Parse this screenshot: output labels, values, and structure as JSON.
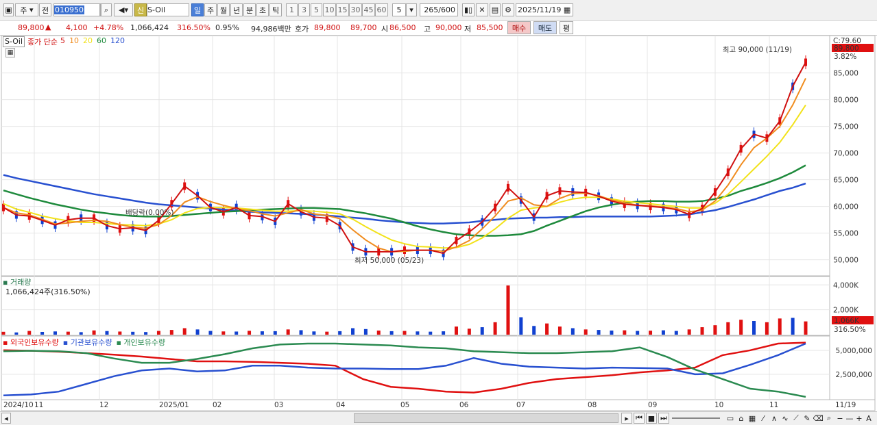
{
  "toolbar": {
    "type_select": "주",
    "prev_label": "전",
    "code": "010950",
    "badge": "신",
    "stock_name": "S-Oil",
    "periods": [
      "일",
      "주",
      "월",
      "년",
      "분",
      "초",
      "틱"
    ],
    "active_period": "일",
    "intervals": [
      "1",
      "3",
      "5",
      "10",
      "15",
      "30",
      "45",
      "60"
    ],
    "interval_value": "5",
    "count": "265",
    "max": "600",
    "date": "2025/11/19"
  },
  "quote": {
    "price": "89,800",
    "change": "4,100",
    "change_pct": "+4.78%",
    "volume": "1,066,424",
    "volume_ratio": "316.50%",
    "turnover": "0.95%",
    "amount": "94,986백만",
    "ask_label": "호가",
    "ask": "89,800",
    "bid": "89,700",
    "open_label": "시",
    "open": "86,500",
    "high_label": "고",
    "high": "90,000",
    "low_label": "저",
    "low": "85,500",
    "buy_btn": "매수",
    "sell_btn": "매도",
    "eval_btn": "평"
  },
  "panels": {
    "price_legend": {
      "name": "S-Oil",
      "label": "종가 단순",
      "periods": [
        "5",
        "10",
        "20",
        "60",
        "120"
      ]
    },
    "volume_title": "거래량",
    "volume_info": "1,066,424주(316.50%)",
    "holding_legend": [
      "외국인보유수량",
      "기관보유수량",
      "개인보유수량"
    ]
  },
  "colors": {
    "up": "#e01010",
    "down": "#1040d0",
    "ma5": "#d01010",
    "ma10": "#f08c1e",
    "ma20": "#f2e21a",
    "ma60": "#1e8a3c",
    "ma120": "#2850d0",
    "foreign": "#e01010",
    "institution": "#2850d0",
    "individual": "#2a8a50"
  },
  "chart_data": [
    {
      "type": "candlestick",
      "title": "S-Oil",
      "ylim": [
        47000,
        92000
      ],
      "yticks": [
        "85,000",
        "80,000",
        "75,000",
        "70,000",
        "65,000",
        "60,000",
        "55,000",
        "50,000"
      ],
      "annotations": {
        "high": "최고 90,000 (11/19)",
        "low": "최저 50,000 (05/23)",
        "dividend": "배당락(0.00%)"
      },
      "right_labels": {
        "c": "C:79.60",
        "last": "89,800",
        "pct": "3.82%"
      },
      "ma": [
        {
          "name": "5",
          "values": [
            59800,
            58400,
            58200,
            57400,
            56500,
            57500,
            57800,
            57800,
            56400,
            55800,
            56000,
            55500,
            57400,
            60500,
            63800,
            62000,
            59800,
            59000,
            59800,
            58300,
            58100,
            57200,
            60500,
            59000,
            58000,
            57800,
            56400,
            52400,
            51500,
            51500,
            51500,
            51800,
            51800,
            51800,
            51200,
            53600,
            55200,
            57100,
            59800,
            63500,
            61200,
            58000,
            62000,
            62900,
            62700,
            62600,
            61900,
            61000,
            60400,
            60200,
            60000,
            59800,
            59400,
            58500,
            59600,
            62700,
            66400,
            70800,
            73500,
            72800,
            76000,
            82500,
            87000
          ]
        },
        {
          "name": "10",
          "values": [
            59800,
            58800,
            58400,
            57600,
            56700,
            56900,
            57200,
            57400,
            57200,
            56600,
            56100,
            55900,
            56600,
            58300,
            60800,
            61800,
            60900,
            60200,
            59600,
            59200,
            58600,
            58200,
            58800,
            59400,
            58600,
            58300,
            57700,
            55600,
            53700,
            52200,
            51500,
            51600,
            51800,
            51800,
            51600,
            52400,
            53600,
            55800,
            58200,
            61000,
            61600,
            60300,
            60000,
            61500,
            62400,
            62500,
            62000,
            61200,
            60700,
            60200,
            60100,
            59900,
            59600,
            59000,
            59300,
            61000,
            64000,
            67800,
            71000,
            72800,
            75000,
            79000,
            84000
          ]
        },
        {
          "name": "20",
          "values": [
            60500,
            59500,
            58900,
            58200,
            57700,
            57300,
            57000,
            57000,
            56800,
            56600,
            56500,
            56400,
            56700,
            57500,
            58800,
            59600,
            59800,
            59800,
            59700,
            59500,
            59300,
            59100,
            59100,
            59200,
            59100,
            58900,
            58600,
            57600,
            56200,
            54900,
            53700,
            53000,
            52500,
            52400,
            52200,
            52300,
            52900,
            54100,
            55800,
            57800,
            59300,
            59700,
            60000,
            60800,
            61400,
            61700,
            61700,
            61400,
            61000,
            60700,
            60500,
            60200,
            60000,
            59700,
            59700,
            60600,
            62300,
            64600,
            67000,
            69400,
            72000,
            75300,
            79000
          ]
        },
        {
          "name": "60",
          "values": [
            63000,
            62300,
            61600,
            61000,
            60400,
            59900,
            59400,
            59000,
            58700,
            58400,
            58200,
            58100,
            58100,
            58200,
            58400,
            58600,
            58800,
            59000,
            59100,
            59300,
            59400,
            59500,
            59600,
            59700,
            59700,
            59600,
            59500,
            59100,
            58700,
            58200,
            57700,
            57000,
            56300,
            55700,
            55200,
            54800,
            54600,
            54500,
            54500,
            54600,
            54800,
            55400,
            56400,
            57300,
            58200,
            59100,
            59800,
            60300,
            60700,
            60900,
            61000,
            61000,
            60900,
            60900,
            61000,
            61400,
            62000,
            62900,
            63600,
            64400,
            65300,
            66400,
            67700
          ]
        },
        {
          "name": "120",
          "values": [
            65900,
            65300,
            64800,
            64300,
            63800,
            63300,
            62800,
            62300,
            61900,
            61500,
            61100,
            60700,
            60400,
            60200,
            60000,
            59800,
            59600,
            59400,
            59200,
            59000,
            58900,
            58800,
            58700,
            58600,
            58500,
            58300,
            58100,
            57900,
            57700,
            57400,
            57200,
            57000,
            56900,
            56800,
            56800,
            56900,
            57000,
            57300,
            57500,
            57700,
            57800,
            57900,
            57900,
            58000,
            58000,
            58100,
            58100,
            58100,
            58100,
            58100,
            58100,
            58200,
            58300,
            58500,
            58900,
            59300,
            59900,
            60600,
            61300,
            62100,
            62900,
            63500,
            64300
          ]
        }
      ]
    },
    {
      "type": "bar",
      "title": "거래량",
      "ylim": [
        0,
        4400
      ],
      "yticks": [
        "4,000K",
        "2,000K"
      ],
      "last_label": "1,066K",
      "pct_label": "316.50%",
      "values": [
        230,
        180,
        300,
        220,
        260,
        240,
        200,
        340,
        290,
        250,
        230,
        210,
        300,
        380,
        520,
        420,
        300,
        260,
        250,
        310,
        270,
        280,
        420,
        360,
        260,
        240,
        280,
        520,
        450,
        330,
        280,
        300,
        260,
        240,
        270,
        650,
        480,
        600,
        1000,
        3950,
        1400,
        700,
        900,
        650,
        520,
        420,
        380,
        330,
        350,
        300,
        320,
        350,
        300,
        420,
        600,
        760,
        1000,
        1200,
        1100,
        1000,
        1300,
        1350,
        1066
      ],
      "up": [
        1,
        0,
        1,
        0,
        0,
        1,
        0,
        1,
        0,
        1,
        0,
        0,
        1,
        1,
        1,
        0,
        0,
        1,
        0,
        1,
        0,
        0,
        1,
        0,
        0,
        1,
        0,
        0,
        0,
        1,
        0,
        1,
        0,
        0,
        0,
        1,
        1,
        0,
        1,
        1,
        0,
        0,
        1,
        1,
        0,
        1,
        0,
        0,
        1,
        0,
        1,
        0,
        0,
        1,
        1,
        1,
        1,
        1,
        0,
        1,
        1,
        0,
        1
      ]
    },
    {
      "type": "line",
      "legend": [
        "외국인보유수량",
        "기관보유수량",
        "개인보유수량"
      ],
      "ylim": [
        0,
        6200000
      ],
      "yticks": [
        "5,000,000",
        "2,500,000"
      ],
      "x_labels": [
        "2024/10",
        "11",
        "12",
        "2025/01",
        "02",
        "03",
        "04",
        "05",
        "06",
        "07",
        "08",
        "09",
        "10",
        "11",
        "11/19"
      ],
      "series": [
        {
          "name": "외국인보유수량",
          "values": [
            5000000,
            4950000,
            4850000,
            4700000,
            4550000,
            4350000,
            4100000,
            3850000,
            3850000,
            3800000,
            3700000,
            3600000,
            3400000,
            2000000,
            1200000,
            1000000,
            700000,
            600000,
            1000000,
            1600000,
            2000000,
            2200000,
            2400000,
            2700000,
            2900000,
            3200000,
            4500000,
            5000000,
            5700000,
            5800000
          ]
        },
        {
          "name": "기관보유수량",
          "values": [
            300000,
            400000,
            700000,
            1500000,
            2300000,
            2900000,
            3100000,
            2800000,
            2900000,
            3400000,
            3400000,
            3200000,
            3100000,
            3100000,
            3050000,
            3050000,
            3400000,
            4200000,
            3600000,
            3300000,
            3200000,
            3100000,
            3200000,
            3150000,
            3100000,
            2500000,
            2600000,
            3500000,
            4500000,
            5700000
          ]
        },
        {
          "name": "개인보유수량",
          "values": [
            4900000,
            4950000,
            4900000,
            4700000,
            4150000,
            3700000,
            3700000,
            4100000,
            4600000,
            5200000,
            5600000,
            5700000,
            5700000,
            5600000,
            5500000,
            5300000,
            5200000,
            4900000,
            4800000,
            4700000,
            4700000,
            4800000,
            4900000,
            5300000,
            4300000,
            3000000,
            2000000,
            1000000,
            700000,
            150000
          ]
        }
      ]
    }
  ]
}
